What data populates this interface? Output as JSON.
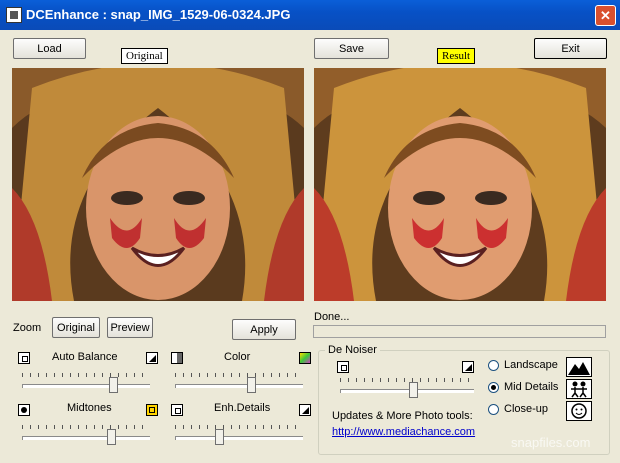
{
  "window": {
    "title": "DCEnhance : snap_IMG_1529-06-0324.JPG",
    "close_glyph": "✕"
  },
  "toolbar": {
    "load": "Load",
    "save": "Save",
    "exit": "Exit",
    "original_tag": "Original",
    "result_tag": "Result"
  },
  "zoom": {
    "label": "Zoom",
    "original": "Original",
    "preview": "Preview",
    "apply": "Apply"
  },
  "status": {
    "text": "Done...",
    "progress": 0
  },
  "sliders": {
    "auto_balance": {
      "label": "Auto Balance",
      "value": 0.72
    },
    "color": {
      "label": "Color",
      "value": 0.6
    },
    "midtones": {
      "label": "Midtones",
      "value": 0.7
    },
    "enh_details": {
      "label": "Enh.Details",
      "value": 0.35
    }
  },
  "denoiser": {
    "label": "De Noiser",
    "value": 0.55,
    "options": [
      {
        "label": "Landscape",
        "checked": false
      },
      {
        "label": "Mid Details",
        "checked": true
      },
      {
        "label": "Close-up",
        "checked": false
      }
    ]
  },
  "updates": {
    "text": "Updates & More Photo tools:",
    "url": "http://www.mediachance.com"
  },
  "watermark": "snapfiles.com"
}
